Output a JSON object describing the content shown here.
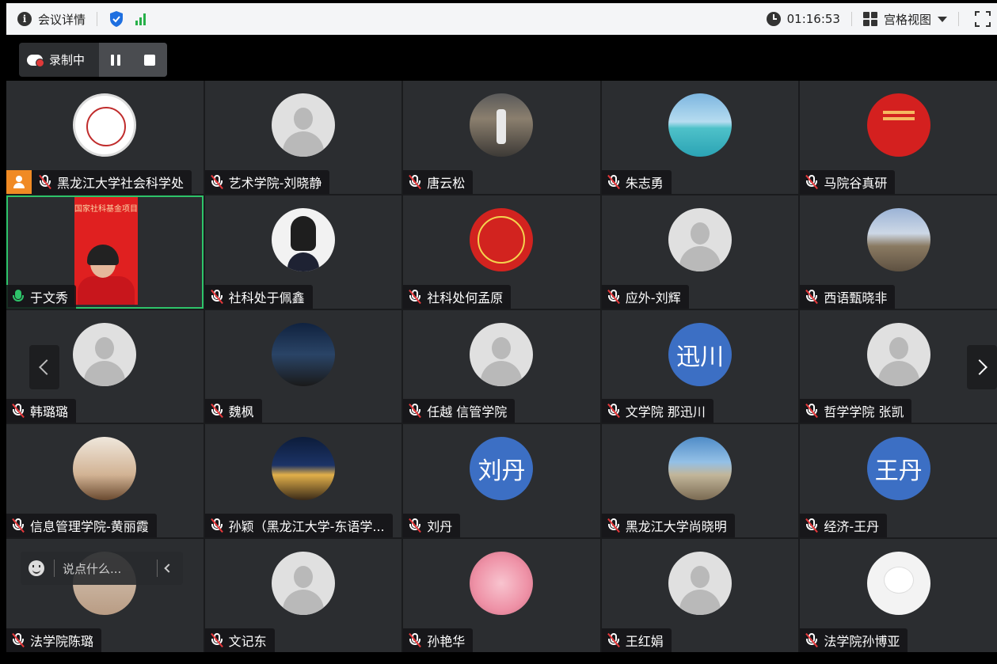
{
  "topbar": {
    "title": "会议详情",
    "timer": "01:16:53",
    "view_label": "宫格视图",
    "icons": [
      "info-icon",
      "shield-icon",
      "signal-icon",
      "clock-icon",
      "grid-icon",
      "fullscreen-icon"
    ],
    "colors": {
      "shield": "#1e6fe0",
      "signal": "#27b04a"
    }
  },
  "recording": {
    "label": "录制中"
  },
  "chat": {
    "placeholder": "说点什么..."
  },
  "participants": [
    {
      "name": "黑龙江大学社会科学处",
      "avatar": "logo1",
      "host": true,
      "mic": "off"
    },
    {
      "name": "艺术学院-刘晓静",
      "avatar": "default",
      "mic": "off"
    },
    {
      "name": "唐云松",
      "avatar": "museum",
      "mic": "off"
    },
    {
      "name": "朱志勇",
      "avatar": "sea",
      "mic": "off"
    },
    {
      "name": "马院谷真研",
      "avatar": "red",
      "mic": "off"
    },
    {
      "name": "于文秀",
      "avatar": "video",
      "mic": "on",
      "active": true,
      "video_banner": "国家社科基金项目"
    },
    {
      "name": "社科处于佩鑫",
      "avatar": "girl",
      "mic": "off"
    },
    {
      "name": "社科处何孟原",
      "avatar": "logo2",
      "mic": "off"
    },
    {
      "name": "应外-刘辉",
      "avatar": "default",
      "mic": "off"
    },
    {
      "name": "西语甄晓非",
      "avatar": "building",
      "mic": "off"
    },
    {
      "name": "韩璐璐",
      "avatar": "default",
      "mic": "off"
    },
    {
      "name": "魏枫",
      "avatar": "night",
      "mic": "off"
    },
    {
      "name": "任越 信管学院",
      "avatar": "default",
      "mic": "off"
    },
    {
      "name": "文学院 那迅川",
      "avatar": "text",
      "avatar_text": "迅川",
      "mic": "off"
    },
    {
      "name": "哲学学院 张凯",
      "avatar": "default",
      "mic": "off"
    },
    {
      "name": "信息管理学院-黄丽霞",
      "avatar": "tea",
      "mic": "off"
    },
    {
      "name": "孙颖（黑龙江大学-东语学...",
      "avatar": "campus",
      "mic": "off"
    },
    {
      "name": "刘丹",
      "avatar": "text",
      "avatar_text": "刘丹",
      "mic": "off"
    },
    {
      "name": "黑龙江大学尚晓明",
      "avatar": "bridge",
      "mic": "off"
    },
    {
      "name": "经济-王丹",
      "avatar": "text",
      "avatar_text": "王丹",
      "mic": "off"
    },
    {
      "name": "法学院陈璐",
      "avatar": "person",
      "mic": "off"
    },
    {
      "name": "文记东",
      "avatar": "default",
      "mic": "off"
    },
    {
      "name": "孙艳华",
      "avatar": "flower",
      "mic": "off"
    },
    {
      "name": "王红娟",
      "avatar": "default",
      "mic": "off"
    },
    {
      "name": "法学院孙博亚",
      "avatar": "cat",
      "mic": "off"
    }
  ]
}
